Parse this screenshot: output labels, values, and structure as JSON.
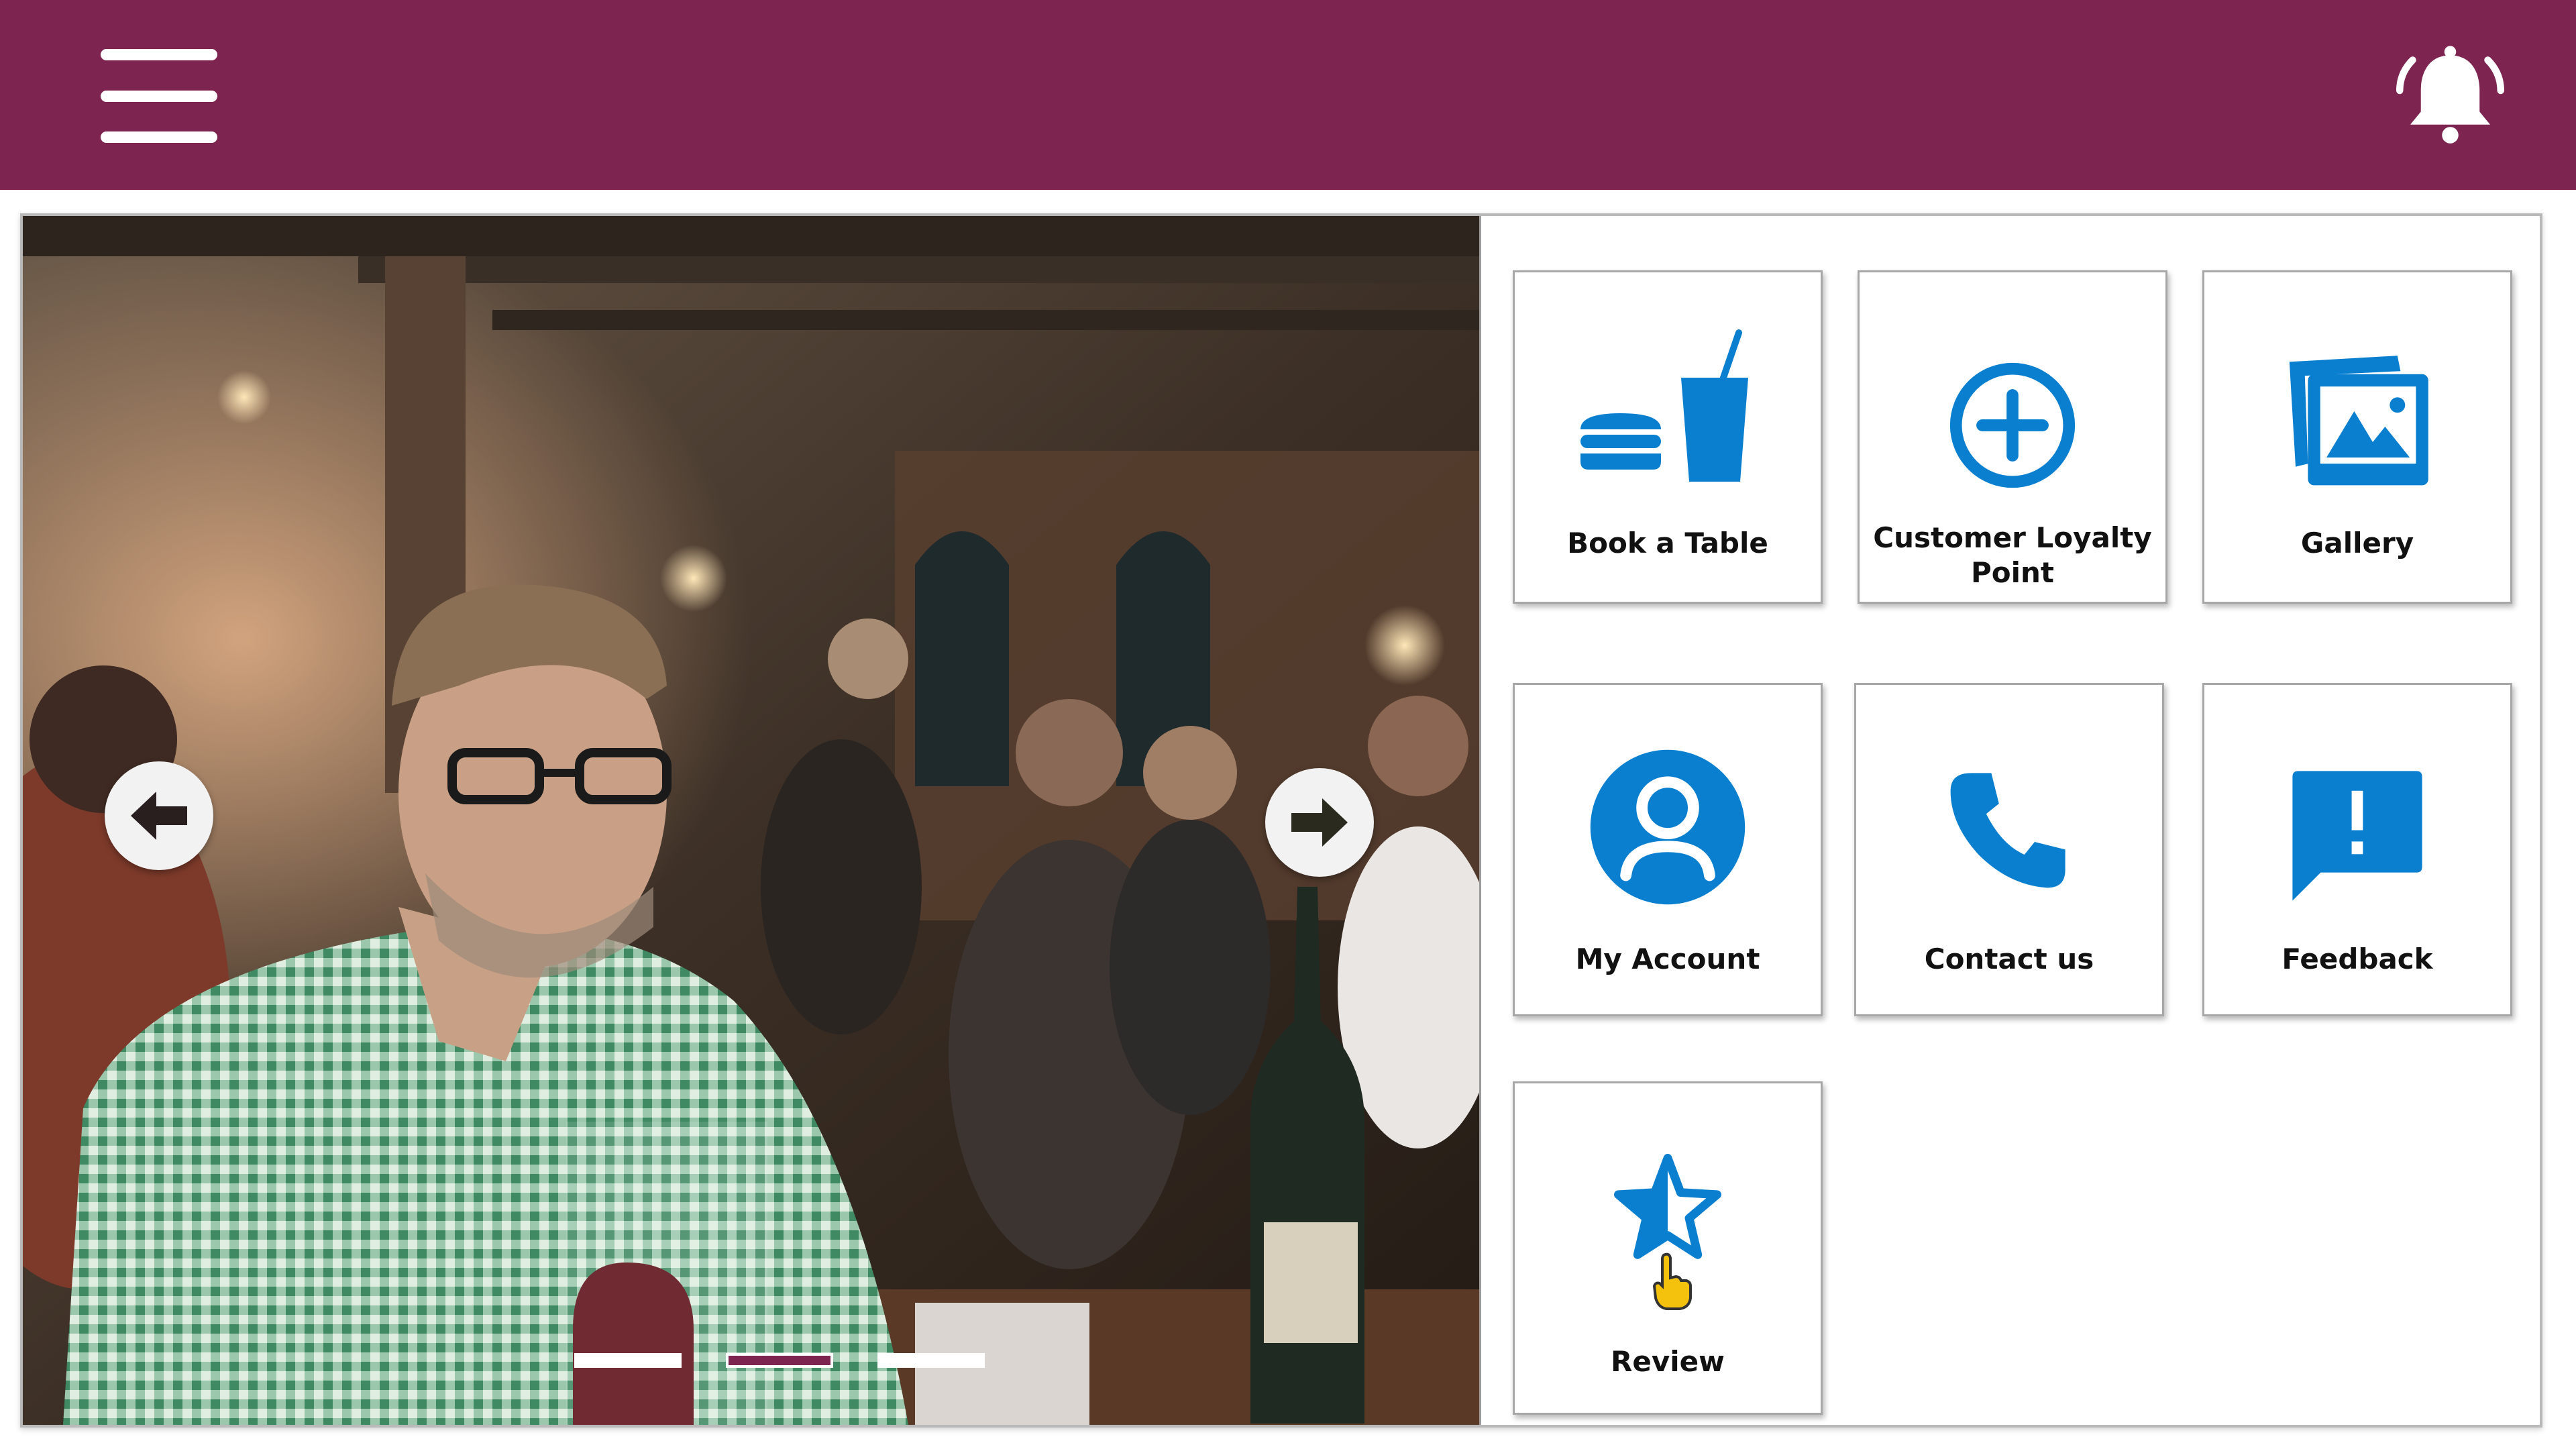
{
  "header": {
    "menu_icon": "hamburger-menu-icon",
    "notification_icon": "bell-ringing-icon",
    "brand_color": "#7d2451"
  },
  "carousel": {
    "slides_count": 3,
    "active_slide": 2,
    "prev_icon": "arrow-left-icon",
    "next_icon": "arrow-right-icon"
  },
  "tiles": [
    {
      "label": "Book a Table",
      "icon": "food-drink-icon"
    },
    {
      "label": "Customer Loyalty Point",
      "icon": "plus-circle-icon"
    },
    {
      "label": "Gallery",
      "icon": "photo-gallery-icon"
    },
    {
      "label": "My Account",
      "icon": "account-circle-icon"
    },
    {
      "label": "Contact us",
      "icon": "phone-icon"
    },
    {
      "label": "Feedback",
      "icon": "feedback-alert-icon"
    },
    {
      "label": "Review",
      "icon": "star-half-icon"
    }
  ],
  "accent_color": "#0a7fd0"
}
